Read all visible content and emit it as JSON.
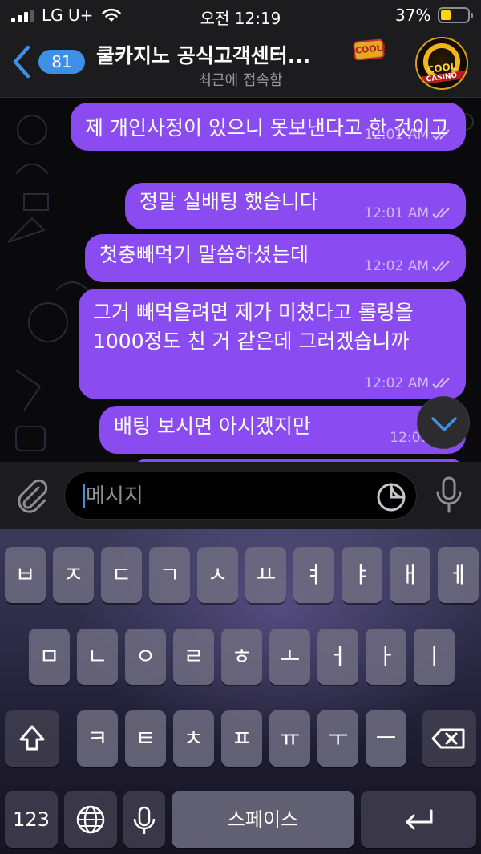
{
  "status_bar": {
    "carrier": "LG U+",
    "time": "오전 12:19",
    "battery": "37%",
    "battery_level": 0.37
  },
  "header": {
    "back_count": "81",
    "title": "쿨카지노 공식고객센터...",
    "badge_text": "COOL!",
    "subtitle": "최근에 접속함",
    "avatar_text_top": "COOL",
    "avatar_text_bottom": "CASINO"
  },
  "messages": [
    {
      "text": "제 개인사정이 있으니 못보낸다고 한 것이고",
      "time": "12:01 AM"
    },
    {
      "text": "정말 실배팅 했습니다",
      "time": "12:01 AM"
    },
    {
      "text": "첫충빼먹기 말씀하셨는데",
      "time": "12:02 AM"
    },
    {
      "text": "그거 빼먹을려면 제가 미쳤다고 롤링을 1000정도 친 거 같은데 그러겠습니까",
      "time": "12:02 AM"
    },
    {
      "text": "배팅 보시면 아시겠지만",
      "time": "12:03 AM"
    }
  ],
  "composer": {
    "placeholder": "메시지"
  },
  "keyboard": {
    "row1": [
      "ㅂ",
      "ㅈ",
      "ㄷ",
      "ㄱ",
      "ㅅ",
      "ㅛ",
      "ㅕ",
      "ㅑ",
      "ㅐ",
      "ㅔ"
    ],
    "row2": [
      "ㅁ",
      "ㄴ",
      "ㅇ",
      "ㄹ",
      "ㅎ",
      "ㅗ",
      "ㅓ",
      "ㅏ",
      "ㅣ"
    ],
    "row3": [
      "ㅋ",
      "ㅌ",
      "ㅊ",
      "ㅍ",
      "ㅠ",
      "ㅜ",
      "ㅡ"
    ],
    "numbers": "123",
    "space": "스페이스"
  }
}
